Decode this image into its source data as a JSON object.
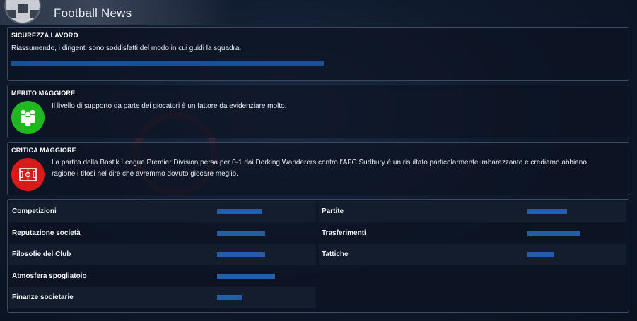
{
  "header": {
    "title": "Football News"
  },
  "job_security": {
    "title": "SICUREZZA LAVORO",
    "text": "Riassumendo, i dirigenti sono soddisfatti del modo in cui guidi la squadra.",
    "level": 0.5
  },
  "biggest_merit": {
    "title": "MERITO MAGGIORE",
    "text": "Il livello di supporto da parte dei giocatori è un fattore da evidenziare molto.",
    "icon": "players-icon",
    "icon_color": "#1fb81f"
  },
  "biggest_criticism": {
    "title": "CRITICA MAGGIORE",
    "text_line1": "La partita della Bostik League Premier Division persa per 0-1 dai Dorking Wanderers contro l'AFC Sudbury è un risultato particolarmente imbarazzante e crediamo abbiano",
    "text_line2": "ragione i tifosi nel dire che avremmo dovuto giocare meglio.",
    "icon": "pitch-icon",
    "icon_color": "#d81a1a"
  },
  "stats_left": [
    {
      "label": "Competizioni",
      "level": 0.46
    },
    {
      "label": "Reputazione società",
      "level": 0.5
    },
    {
      "label": "Filosofie del Club",
      "level": 0.5
    },
    {
      "label": "Atmosfera spogliatoio",
      "level": 0.6
    },
    {
      "label": "Finanze societarie",
      "level": 0.25
    }
  ],
  "stats_right": [
    {
      "label": "Partite",
      "level": 0.41
    },
    {
      "label": "Trasferimenti",
      "level": 0.55
    },
    {
      "label": "Tattiche",
      "level": 0.28
    }
  ],
  "colors": {
    "bar": "#245ea8",
    "border": "#3a4a63"
  }
}
